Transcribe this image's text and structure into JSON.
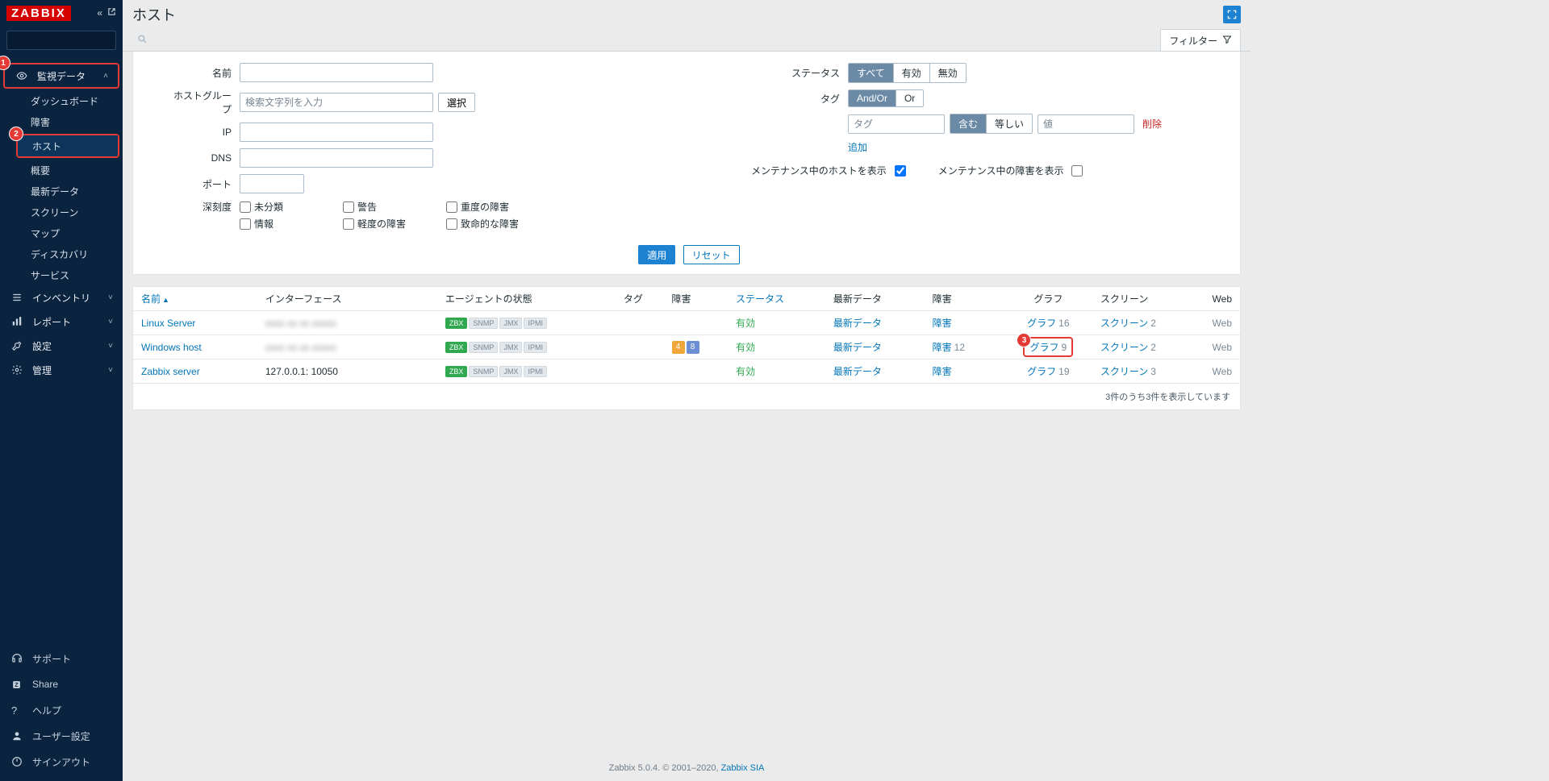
{
  "logo": "ZABBIX",
  "page_title": "ホスト",
  "sidebar": {
    "monitoring": {
      "label": "監視データ",
      "subs": [
        "ダッシュボード",
        "障害",
        "ホスト",
        "概要",
        "最新データ",
        "スクリーン",
        "マップ",
        "ディスカバリ",
        "サービス"
      ]
    },
    "inventory": "インベントリ",
    "reports": "レポート",
    "config": "設定",
    "admin": "管理",
    "bottom": [
      "サポート",
      "Share",
      "ヘルプ",
      "ユーザー設定",
      "サインアウト"
    ]
  },
  "callouts": [
    "1",
    "2",
    "3"
  ],
  "filter_tab": "フィルター",
  "filter": {
    "name": "名前",
    "hostgroup": "ホストグループ",
    "hostgroup_ph": "検索文字列を入力",
    "select_btn": "選択",
    "ip": "IP",
    "dns": "DNS",
    "port": "ポート",
    "severity": "深刻度",
    "sev_opts": [
      "未分類",
      "警告",
      "重度の障害",
      "情報",
      "軽度の障害",
      "致命的な障害"
    ],
    "status": "ステータス",
    "status_opts": [
      "すべて",
      "有効",
      "無効"
    ],
    "tag": "タグ",
    "tag_opts": [
      "And/Or",
      "Or"
    ],
    "tag_ph1": "タグ",
    "tag_mode_opts": [
      "含む",
      "等しい"
    ],
    "tag_ph2": "値",
    "tag_remove": "削除",
    "tag_add": "追加",
    "maint_host": "メンテナンス中のホストを表示",
    "maint_prob": "メンテナンス中の障害を表示",
    "apply": "適用",
    "reset": "リセット"
  },
  "table": {
    "headers": {
      "name": "名前",
      "interface": "インターフェース",
      "agent": "エージェントの状態",
      "tag": "タグ",
      "problems": "障害",
      "status": "ステータス",
      "latest": "最新データ",
      "problems2": "障害",
      "graph": "グラフ",
      "screen": "スクリーン",
      "web": "Web"
    },
    "agent_badges": [
      "ZBX",
      "SNMP",
      "JMX",
      "IPMI"
    ],
    "status_label": "有効",
    "latest_label": "最新データ",
    "prob_label": "障害",
    "graph_label": "グラフ",
    "screen_label": "スクリーン",
    "web_label": "Web",
    "rows": [
      {
        "name": "Linux Server",
        "interface": "",
        "zbx": "green",
        "tags": [],
        "prob_count": "",
        "graph": "16",
        "screen": "2"
      },
      {
        "name": "Windows host",
        "interface": "",
        "zbx": "green",
        "tags": [
          "4",
          "8"
        ],
        "prob_count": "12",
        "graph": "9",
        "screen": "2",
        "hl": true
      },
      {
        "name": "Zabbix server",
        "interface": "127.0.0.1: 10050",
        "zbx": "green",
        "tags": [],
        "prob_count": "",
        "graph": "19",
        "screen": "3"
      }
    ],
    "footer": "3件のうち3件を表示しています"
  },
  "footer": {
    "left": "Zabbix 5.0.4. © 2001–2020, ",
    "link": "Zabbix SIA"
  }
}
